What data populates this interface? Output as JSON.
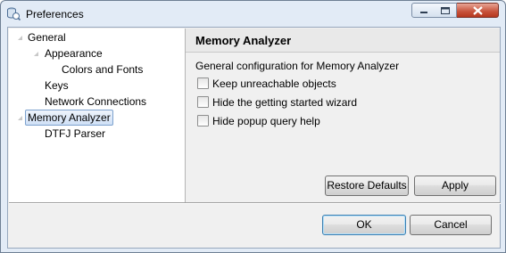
{
  "window": {
    "title": "Preferences",
    "controls": {
      "minimize": "minimize",
      "maximize": "maximize",
      "close": "close"
    }
  },
  "tree": {
    "items": [
      {
        "label": "General",
        "expanded": true,
        "selected": false
      },
      {
        "label": "Appearance",
        "expanded": true,
        "selected": false
      },
      {
        "label": "Colors and Fonts",
        "selected": false
      },
      {
        "label": "Keys",
        "selected": false
      },
      {
        "label": "Network Connections",
        "selected": false
      },
      {
        "label": "Memory Analyzer",
        "expanded": true,
        "selected": true
      },
      {
        "label": "DTFJ Parser",
        "selected": false
      }
    ]
  },
  "page": {
    "title": "Memory Analyzer",
    "description": "General configuration for Memory Analyzer",
    "options": [
      {
        "label": "Keep unreachable objects",
        "checked": false
      },
      {
        "label": "Hide the getting started wizard",
        "checked": false
      },
      {
        "label": "Hide popup query help",
        "checked": false
      }
    ],
    "restore_defaults_label": "Restore Defaults",
    "apply_label": "Apply"
  },
  "dialog": {
    "ok_label": "OK",
    "cancel_label": "Cancel"
  },
  "icons": {
    "app": "preferences-icon",
    "expand": "expand-arrow-icon"
  },
  "colors": {
    "selection_border": "#7da2ce",
    "default_button_border": "#3c7fb1",
    "close_button": "#c7523b"
  }
}
